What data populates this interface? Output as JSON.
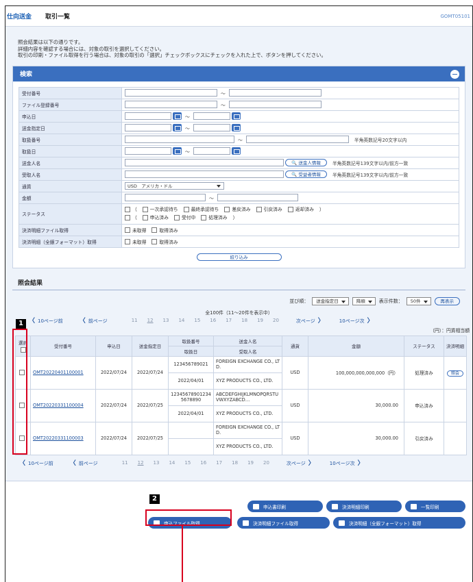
{
  "header": {
    "breadcrumb": "仕向送金",
    "title": "取引一覧",
    "code": "GOMT05101"
  },
  "intro": [
    "照会結果は以下の通りです。",
    "詳細内容を確認する場合には、対象の取引を選択してください。",
    "取引の印刷・ファイル取得を行う場合は、対象の取引の「選択」チェックボックスにチェックを入れた上で、ボタンを押してください。"
  ],
  "search": {
    "title": "検索",
    "labels": [
      "受付番号",
      "ファイル登録番号",
      "申込日",
      "送金指定日",
      "取扱番号",
      "取扱日",
      "送金人名",
      "受取人名",
      "通貨",
      "金額",
      "ステータス",
      "決済明細ファイル取得",
      "決済明細（全銀フォーマット）取得"
    ],
    "tilde": "～",
    "remitter_btn": "送金人情報",
    "beneficiary_btn": "受益者情報",
    "note_alnum20": "半角英数記号20文字以内",
    "note_alnum139": "半角英数記号139文字以内/前方一致",
    "currency_value": "USD　アメリカ・ドル",
    "status_row1": [
      "一次承認待ち",
      "最終承認待ち",
      "差戻済み",
      "引戻済み",
      "返却済み"
    ],
    "status_row2": [
      "申込済み",
      "受付中",
      "処理済み"
    ],
    "status_paren_open": "（",
    "status_paren_close1": "）",
    "status_paren_close2": "）",
    "file_opts": [
      "未取得",
      "取得済み"
    ],
    "narrow_btn": "絞り込み"
  },
  "results": {
    "title": "照会結果",
    "sort_label": "並び順：",
    "sort_value": "送金指定日",
    "order_value": "降順",
    "count_label": "表示件数：",
    "count_value": "50件",
    "redisplay": "再表示",
    "total": "全100件（11～20件を表示中）",
    "pager": {
      "prev10": "10ページ前",
      "prev": "前ページ",
      "pages": [
        "11",
        "12",
        "13",
        "14",
        "15",
        "16",
        "17",
        "18",
        "19",
        "20"
      ],
      "current": "12",
      "next": "次ページ",
      "next10": "10ページ次"
    },
    "unit_note": "（円）：円貨相当額",
    "headers": {
      "select": "選択",
      "receipt": "受付番号",
      "apply_date": "申込日",
      "remit_date": "送金指定日",
      "handle_no": "取扱番号",
      "handle_date": "取扱日",
      "remitter": "送金人名",
      "beneficiary": "受取人名",
      "currency": "通貨",
      "amount": "金額",
      "status": "ステータス",
      "detail": "決済明細"
    },
    "rows": [
      {
        "receipt": "OMT20220401100001",
        "apply": "2022/07/24",
        "remit": "2022/07/24",
        "handle_no": "123456789021",
        "handle_date": "2022/04/01",
        "remitter": "FOREIGN EXCHANGE CO., LTD.",
        "beneficiary": "XYZ PRODUCTS CO., LTD.",
        "currency": "USD",
        "amount": "100,000,000,000,000（円）",
        "status": "処理済み",
        "detail": "照会"
      },
      {
        "receipt": "OMT20220331100004",
        "apply": "2022/07/24",
        "remit": "2022/07/25",
        "handle_no": "123456789012345678890",
        "handle_date": "2022/04/01",
        "remitter": "ABCDEFGHIJKLMNOPQRSTUVWXYZABCD…",
        "beneficiary": "XYZ PRODUCTS CO., LTD.",
        "currency": "USD",
        "amount": "30,000.00",
        "status": "申込済み",
        "detail": ""
      },
      {
        "receipt": "OMT20220331100003",
        "apply": "2022/07/24",
        "remit": "2022/07/25",
        "handle_no": "",
        "handle_date": "",
        "remitter": "FOREIGN EXCHANGE CO., LTD.",
        "beneficiary": "XYZ PRODUCTS CO., LTD.",
        "currency": "USD",
        "amount": "30,000.00",
        "status": "引戻済み",
        "detail": ""
      }
    ]
  },
  "buttons": {
    "print_apply": "申込書印刷",
    "print_detail": "決済明細印刷",
    "print_list": "一覧印刷",
    "get_apply_file": "申込ファイル取得",
    "get_detail_file": "決済明細ファイル取得",
    "get_zengin": "決済明細（全銀フォーマット）取得"
  },
  "badges": {
    "one": "1",
    "two": "2"
  },
  "colors": {
    "accent": "#3a6fbf",
    "highlight": "#d8001e"
  }
}
